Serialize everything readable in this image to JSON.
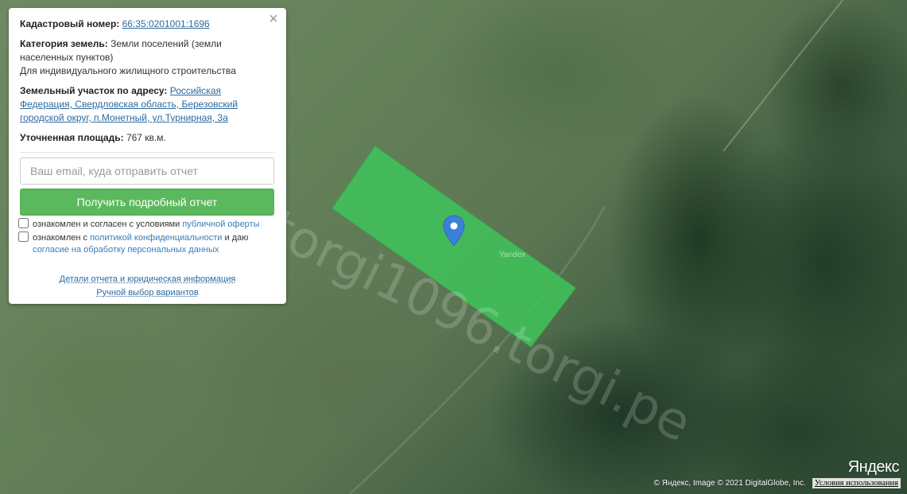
{
  "panel": {
    "close_glyph": "×",
    "cadastral_label": "Кадастровый номер:",
    "cadastral_number": "66:35:0201001:1696",
    "category_label": "Категория земель:",
    "category_value": "Земли поселений (земли населенных пунктов)",
    "category_use": "Для индивидуального жилищного строительства",
    "address_label": "Земельный участок по адресу:",
    "address_value": "Российская Федерация, Свердловская область, Березовский городской округ, п.Монетный, ул.Турнирная, 3а",
    "area_label": "Уточненная площадь:",
    "area_value": "767 кв.м.",
    "email_placeholder": "Ваш email, куда отправить отчет",
    "report_button": "Получить подробный отчет",
    "offer_text": "ознакомлен и согласен с условиями",
    "offer_link": "публичной оферты",
    "privacy_text": "ознакомлен с",
    "privacy_link": "политикой конфиденциальности",
    "privacy_and": "и даю",
    "consent_link": "согласие на обработку персональных данных",
    "details_link": "Детали отчета и юридическая информация",
    "manual_link": "Ручной выбор вариантов"
  },
  "map": {
    "watermark": "torgi1096.torgi.pe",
    "parcel_label": "Yandex",
    "parcel_color": "#3fc45a",
    "marker_color": "#3d7fd6",
    "logo": "Яндекс",
    "copyright": "© Яндекс, Image © 2021 DigitalGlobe, Inc.",
    "terms": "Условия использования"
  },
  "colors": {
    "accent_green": "#5cb85c",
    "link_blue": "#2c6aa0"
  }
}
